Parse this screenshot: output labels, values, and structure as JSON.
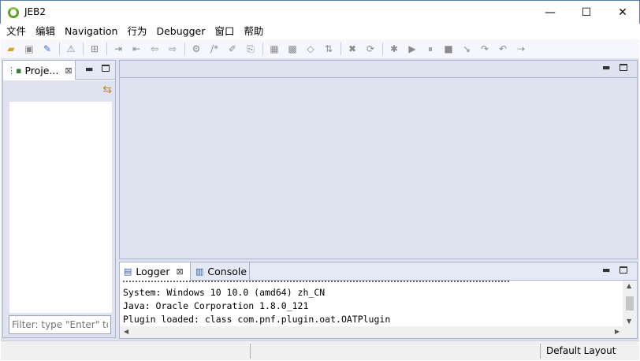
{
  "window": {
    "title": "JEB2",
    "minimize_glyph": "—",
    "maximize_glyph": "☐",
    "close_glyph": "✕"
  },
  "menu": [
    "文件",
    "编辑",
    "Navigation",
    "行为",
    "Debugger",
    "窗口",
    "帮助"
  ],
  "toolbar_icons": [
    "open-icon",
    "save-icon",
    "wrench-icon",
    "warning-icon",
    "new-file-icon",
    "navigate-in-icon",
    "navigate-out-icon",
    "back-icon",
    "forward-icon",
    "refactor-icon",
    "comment-icon",
    "edit-icon",
    "export-icon",
    "grid-icon",
    "grid-plus-icon",
    "decompile-icon",
    "parse-icon",
    "delete-icon",
    "sync-icon",
    "debug-icon",
    "run-icon",
    "pause-icon",
    "stop-icon",
    "step-into-icon",
    "step-over-icon",
    "step-return-icon",
    "run-to-line-icon"
  ],
  "project_panel": {
    "tab_label": "Proje...",
    "filter_placeholder": "Filter: type \"Enter\" to"
  },
  "bottom_panel": {
    "tabs": [
      {
        "label": "Logger",
        "icon": "logger-icon"
      },
      {
        "label": "Console",
        "icon": "console-icon"
      }
    ],
    "log_lines": [
      "System: Windows 10 10.0 (amd64) zh_CN",
      "Java: Oracle Corporation 1.8.0_121",
      "Plugin loaded: class com.pnf.plugin.oat.OATPlugin"
    ]
  },
  "statusbar": {
    "layout": "Default Layout"
  }
}
